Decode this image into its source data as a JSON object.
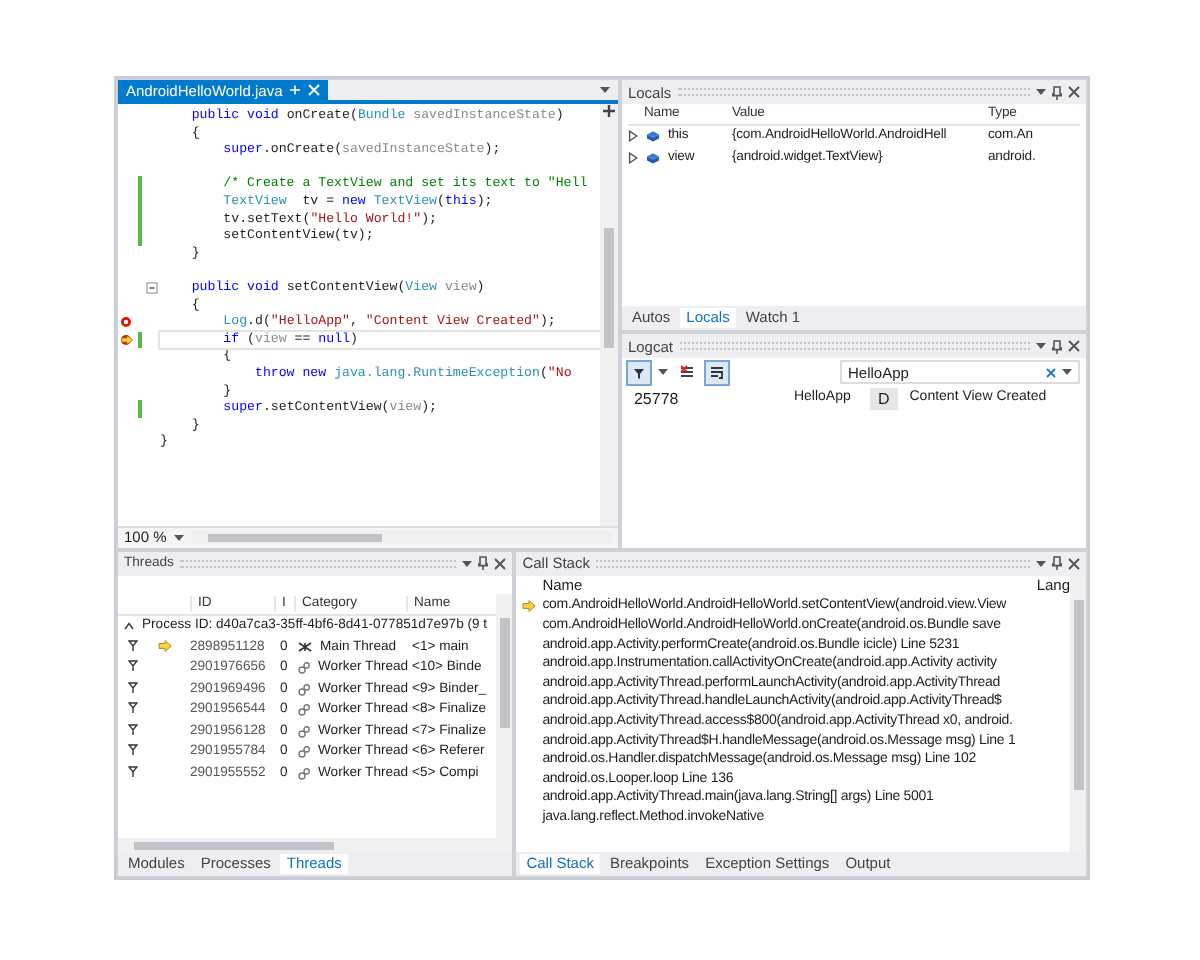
{
  "editor": {
    "tab": {
      "title": "AndroidHelloWorld.java",
      "selected": true
    },
    "zoom": "100 %",
    "lines": [
      {
        "changed": false,
        "breakpoint": false,
        "current": false,
        "fold": false,
        "tokens": [
          {
            "text": "    public void",
            "kind": "kw"
          },
          {
            "text": " onCreate(",
            "kind": "plain"
          },
          {
            "text": "Bundle",
            "kind": "type"
          },
          {
            "text": " savedInstanceState",
            "kind": "param"
          },
          {
            "text": ")",
            "kind": "plain"
          }
        ]
      },
      {
        "changed": false,
        "breakpoint": false,
        "current": false,
        "fold": false,
        "tokens": [
          {
            "text": "    {",
            "kind": "plain"
          }
        ]
      },
      {
        "changed": false,
        "breakpoint": false,
        "current": false,
        "fold": false,
        "tokens": [
          {
            "text": "        super",
            "kind": "kw"
          },
          {
            "text": ".onCreate(",
            "kind": "plain"
          },
          {
            "text": "savedInstanceState",
            "kind": "param"
          },
          {
            "text": ");",
            "kind": "plain"
          }
        ]
      },
      {
        "changed": false,
        "breakpoint": false,
        "current": false,
        "fold": false
      },
      {
        "changed": true,
        "breakpoint": false,
        "current": false,
        "fold": false,
        "tokens": [
          {
            "text": "        /* Create a TextView and set its text to \"Hell",
            "kind": "comment"
          }
        ]
      },
      {
        "changed": true,
        "breakpoint": false,
        "current": false,
        "fold": false,
        "tokens": [
          {
            "text": "        TextView",
            "kind": "type"
          },
          {
            "text": "  tv = ",
            "kind": "plain"
          },
          {
            "text": "new",
            "kind": "kw"
          },
          {
            "text": " TextView",
            "kind": "type"
          },
          {
            "text": "(",
            "kind": "plain"
          },
          {
            "text": "this",
            "kind": "kw"
          },
          {
            "text": ");",
            "kind": "plain"
          }
        ]
      },
      {
        "changed": true,
        "breakpoint": false,
        "current": false,
        "fold": false,
        "tokens": [
          {
            "text": "        tv.setText(",
            "kind": "plain"
          },
          {
            "text": "\"Hello World!\"",
            "kind": "str"
          },
          {
            "text": ");",
            "kind": "plain"
          }
        ]
      },
      {
        "changed": true,
        "breakpoint": false,
        "current": false,
        "fold": false,
        "tokens": [
          {
            "text": "        setContentView(tv);",
            "kind": "plain"
          }
        ]
      },
      {
        "changed": false,
        "breakpoint": false,
        "current": false,
        "fold": false,
        "tokens": [
          {
            "text": "    }",
            "kind": "plain"
          }
        ]
      },
      {
        "changed": false,
        "breakpoint": false,
        "current": false,
        "fold": false
      },
      {
        "changed": false,
        "breakpoint": false,
        "current": false,
        "fold": true,
        "tokens": [
          {
            "text": "    public void",
            "kind": "kw"
          },
          {
            "text": " setContentView(",
            "kind": "plain"
          },
          {
            "text": "View",
            "kind": "type"
          },
          {
            "text": " view",
            "kind": "param"
          },
          {
            "text": ")",
            "kind": "plain"
          }
        ]
      },
      {
        "changed": false,
        "breakpoint": false,
        "current": false,
        "fold": false,
        "tokens": [
          {
            "text": "    {",
            "kind": "plain"
          }
        ]
      },
      {
        "changed": false,
        "breakpoint": true,
        "current": false,
        "fold": false,
        "tokens": [
          {
            "text": "        Log",
            "kind": "type"
          },
          {
            "text": ".d(",
            "kind": "plain"
          },
          {
            "text": "\"HelloApp\"",
            "kind": "str"
          },
          {
            "text": ", ",
            "kind": "plain"
          },
          {
            "text": "\"Content View Created\"",
            "kind": "str"
          },
          {
            "text": ");",
            "kind": "plain"
          }
        ]
      },
      {
        "changed": true,
        "breakpoint": false,
        "current": true,
        "fold": false,
        "tokens": [
          {
            "text": "        if",
            "kind": "kw"
          },
          {
            "text": " (",
            "kind": "plain"
          },
          {
            "text": "view",
            "kind": "param"
          },
          {
            "text": " == ",
            "kind": "plain"
          },
          {
            "text": "null",
            "kind": "kw"
          },
          {
            "text": ")",
            "kind": "plain"
          }
        ]
      },
      {
        "changed": false,
        "breakpoint": false,
        "current": false,
        "fold": false,
        "tokens": [
          {
            "text": "        {",
            "kind": "plain"
          }
        ]
      },
      {
        "changed": false,
        "breakpoint": false,
        "current": false,
        "fold": false,
        "tokens": [
          {
            "text": "            throw new",
            "kind": "kw"
          },
          {
            "text": " java.lang.RuntimeException",
            "kind": "type"
          },
          {
            "text": "(",
            "kind": "plain"
          },
          {
            "text": "\"No",
            "kind": "str"
          }
        ]
      },
      {
        "changed": false,
        "breakpoint": false,
        "current": false,
        "fold": false,
        "tokens": [
          {
            "text": "        }",
            "kind": "plain"
          }
        ]
      },
      {
        "changed": true,
        "breakpoint": false,
        "current": false,
        "fold": false,
        "tokens": [
          {
            "text": "        super",
            "kind": "kw"
          },
          {
            "text": ".setContentView(",
            "kind": "plain"
          },
          {
            "text": "view",
            "kind": "param"
          },
          {
            "text": ");",
            "kind": "plain"
          }
        ]
      },
      {
        "changed": false,
        "breakpoint": false,
        "current": false,
        "fold": false,
        "tokens": [
          {
            "text": "    }",
            "kind": "plain"
          }
        ]
      },
      {
        "changed": false,
        "breakpoint": false,
        "current": false,
        "fold": false,
        "tokens": [
          {
            "text": "}",
            "kind": "plain"
          }
        ]
      }
    ]
  },
  "locals": {
    "title": "Locals",
    "columns": [
      "Name",
      "Value",
      "Type"
    ],
    "rows": [
      {
        "name": "this",
        "value": "{com.AndroidHelloWorld.AndroidHell",
        "type": "com.An",
        "expanded": false
      },
      {
        "name": "view",
        "value": "{android.widget.TextView}",
        "type": "android.",
        "expanded": false
      }
    ],
    "tabs": [
      {
        "label": "Autos",
        "selected": false
      },
      {
        "label": "Locals",
        "selected": true
      },
      {
        "label": "Watch 1",
        "selected": false
      }
    ]
  },
  "logcat": {
    "title": "Logcat",
    "toolbar": [
      {
        "kind": "filter",
        "pressed": true
      },
      {
        "kind": "clear",
        "pressed": false
      },
      {
        "kind": "wrap",
        "pressed": true
      }
    ],
    "search": {
      "value": "HelloApp"
    },
    "entries": [
      {
        "pid": "25778",
        "tag": "HelloApp",
        "level": "D",
        "message": "Content View Created"
      }
    ]
  },
  "threads": {
    "title": "Threads",
    "columns": [
      "ID",
      "I",
      "Category",
      "Name"
    ],
    "process": "Process ID: d40a7ca3-35ff-4bf6-8d41-077851d7e97b (9 t",
    "rows": [
      {
        "id": "2898951128",
        "i": "0",
        "category": "Main Thread",
        "name": "<1> main",
        "current": true,
        "kind": "main"
      },
      {
        "id": "2901976656",
        "i": "0",
        "category": "Worker Thread",
        "name": "<10> Binde",
        "current": false,
        "kind": "worker"
      },
      {
        "id": "2901969496",
        "i": "0",
        "category": "Worker Thread",
        "name": "<9> Binder_",
        "current": false,
        "kind": "worker"
      },
      {
        "id": "2901956544",
        "i": "0",
        "category": "Worker Thread",
        "name": "<8> Finalize",
        "current": false,
        "kind": "worker"
      },
      {
        "id": "2901956128",
        "i": "0",
        "category": "Worker Thread",
        "name": "<7> Finalize",
        "current": false,
        "kind": "worker"
      },
      {
        "id": "2901955784",
        "i": "0",
        "category": "Worker Thread",
        "name": "<6> Referer",
        "current": false,
        "kind": "worker"
      },
      {
        "id": "2901955552",
        "i": "0",
        "category": "Worker Thread",
        "name": "<5> Compi",
        "current": false,
        "kind": "worker"
      }
    ],
    "tabs": [
      {
        "label": "Modules",
        "selected": false
      },
      {
        "label": "Processes",
        "selected": false
      },
      {
        "label": "Threads",
        "selected": true
      }
    ]
  },
  "callstack": {
    "title": "Call Stack",
    "columns": [
      "Name",
      "Lang"
    ],
    "rows": [
      {
        "text": "com.AndroidHelloWorld.AndroidHelloWorld.setContentView(android.view.View",
        "current": true
      },
      {
        "text": "com.AndroidHelloWorld.AndroidHelloWorld.onCreate(android.os.Bundle save",
        "current": false
      },
      {
        "text": "android.app.Activity.performCreate(android.os.Bundle icicle) Line 5231",
        "current": false
      },
      {
        "text": "android.app.Instrumentation.callActivityOnCreate(android.app.Activity activity",
        "current": false
      },
      {
        "text": "android.app.ActivityThread.performLaunchActivity(android.app.ActivityThread",
        "current": false
      },
      {
        "text": "android.app.ActivityThread.handleLaunchActivity(android.app.ActivityThread$",
        "current": false
      },
      {
        "text": "android.app.ActivityThread.access$800(android.app.ActivityThread x0, android.",
        "current": false
      },
      {
        "text": "android.app.ActivityThread$H.handleMessage(android.os.Message msg) Line 1",
        "current": false
      },
      {
        "text": "android.os.Handler.dispatchMessage(android.os.Message msg) Line 102",
        "current": false
      },
      {
        "text": "android.os.Looper.loop Line 136",
        "current": false
      },
      {
        "text": "android.app.ActivityThread.main(java.lang.String[] args) Line 5001",
        "current": false
      },
      {
        "text": "java.lang.reflect.Method.invokeNative",
        "current": false
      }
    ],
    "tabs": [
      {
        "label": "Call Stack",
        "selected": true
      },
      {
        "label": "Breakpoints",
        "selected": false
      },
      {
        "label": "Exception Settings",
        "selected": false
      },
      {
        "label": "Output",
        "selected": false
      }
    ]
  }
}
